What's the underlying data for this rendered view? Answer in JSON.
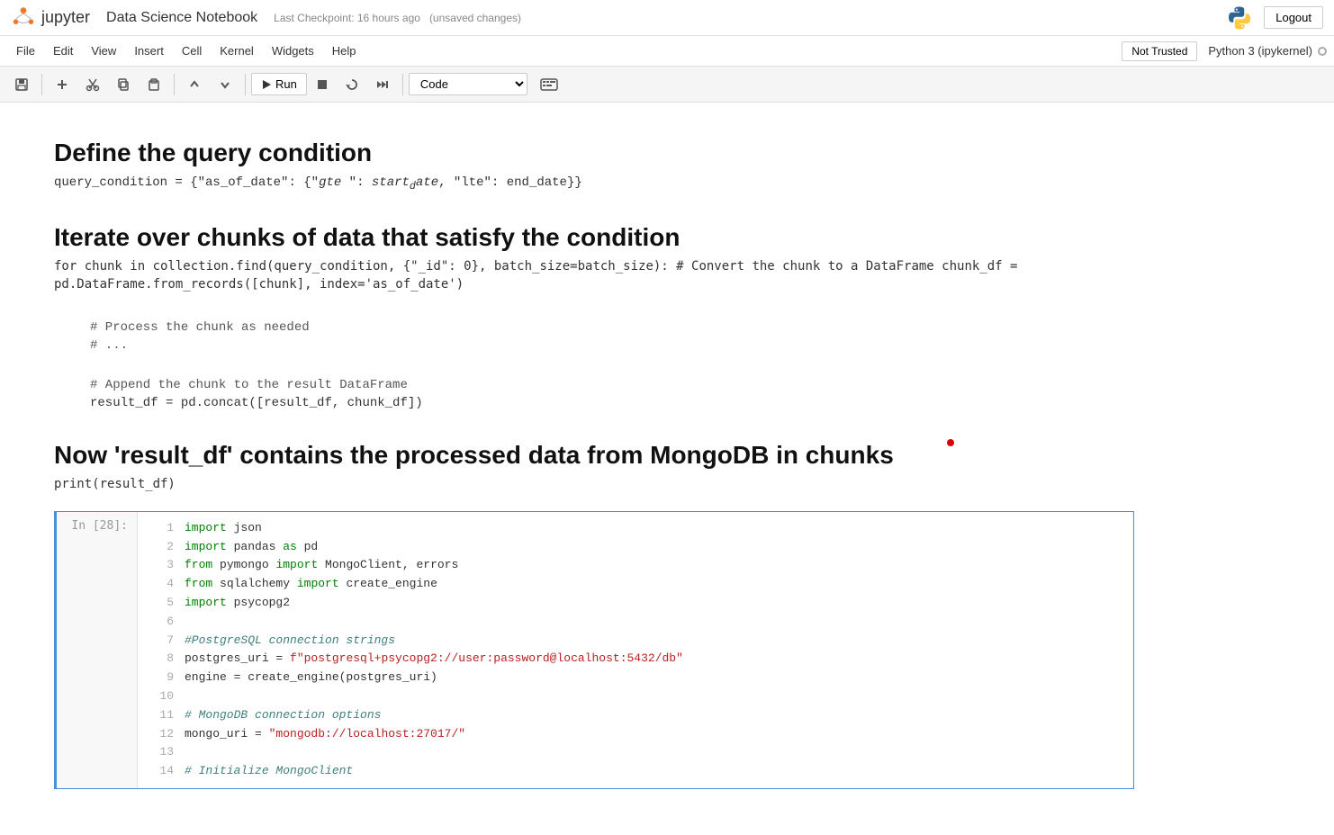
{
  "topbar": {
    "brand": "jupyter",
    "notebook_title": "Data Science Notebook",
    "checkpoint_text": "Last Checkpoint: 16 hours ago",
    "unsaved": "(unsaved changes)",
    "logout_label": "Logout"
  },
  "menubar": {
    "items": [
      "File",
      "Edit",
      "View",
      "Insert",
      "Cell",
      "Kernel",
      "Widgets",
      "Help"
    ],
    "not_trusted_label": "Not Trusted",
    "kernel_info": "Python 3 (ipykernel)"
  },
  "toolbar": {
    "cell_type": "Code",
    "run_label": "Run"
  },
  "notebook": {
    "section1": {
      "heading": "Define the query condition",
      "code_line": "query_condition = {\"as_of_date\": {\"gte \": start_date, \"lte\": end_date}}"
    },
    "section2": {
      "heading": "Iterate over chunks of data that satisfy the condition",
      "code_line1": "for chunk in collection.find(query_condition, {\"_id\": 0}, batch_size=batch_size): # Convert the chunk to a DataFrame chunk_df =",
      "code_line2": "pd.DataFrame.from_records([chunk], index='as_of_date')",
      "comment1": "# Process the chunk as needed",
      "comment2": "# ...",
      "comment3": "# Append the chunk to the result DataFrame",
      "code_concat": "result_df = pd.concat([result_df, chunk_df])"
    },
    "section3": {
      "heading": "Now 'result_df' contains the processed data from MongoDB in chunks",
      "print_line": "print(result_df)"
    },
    "code_cell": {
      "prompt": "In [28]:",
      "lines": [
        {
          "num": 1,
          "code": "import json",
          "parts": [
            {
              "text": "import ",
              "cls": "kw"
            },
            {
              "text": "json",
              "cls": "normal"
            }
          ]
        },
        {
          "num": 2,
          "code": "import pandas as pd",
          "parts": [
            {
              "text": "import ",
              "cls": "kw"
            },
            {
              "text": "pandas ",
              "cls": "normal"
            },
            {
              "text": "as",
              "cls": "kw2"
            },
            {
              "text": " pd",
              "cls": "normal"
            }
          ]
        },
        {
          "num": 3,
          "code": "from pymongo import MongoClient, errors",
          "parts": [
            {
              "text": "from ",
              "cls": "kw"
            },
            {
              "text": "pymongo ",
              "cls": "normal"
            },
            {
              "text": "import ",
              "cls": "kw"
            },
            {
              "text": "MongoClient, errors",
              "cls": "normal"
            }
          ]
        },
        {
          "num": 4,
          "code": "from sqlalchemy import create_engine",
          "parts": [
            {
              "text": "from ",
              "cls": "kw"
            },
            {
              "text": "sqlalchemy ",
              "cls": "normal"
            },
            {
              "text": "import ",
              "cls": "kw"
            },
            {
              "text": "create_engine",
              "cls": "normal"
            }
          ]
        },
        {
          "num": 5,
          "code": "import psycopg2",
          "parts": [
            {
              "text": "import ",
              "cls": "kw"
            },
            {
              "text": "psycopg2",
              "cls": "normal"
            }
          ]
        },
        {
          "num": 6,
          "code": "",
          "parts": []
        },
        {
          "num": 7,
          "code": "#PostgreSQL connection strings",
          "parts": [
            {
              "text": "#PostgreSQL connection strings",
              "cls": "cm"
            }
          ]
        },
        {
          "num": 8,
          "code": "postgres_uri = f\"postgresql+psycopg2://user:password@localhost:5432/db\"",
          "parts": [
            {
              "text": "postgres_uri ",
              "cls": "normal"
            },
            {
              "text": "= ",
              "cls": "normal"
            },
            {
              "text": "f\"postgresql+psycopg2://user:password@localhost:5432/db\"",
              "cls": "str"
            }
          ]
        },
        {
          "num": 9,
          "code": "engine = create_engine(postgres_uri)",
          "parts": [
            {
              "text": "engine ",
              "cls": "normal"
            },
            {
              "text": "= ",
              "cls": "normal"
            },
            {
              "text": "create_engine",
              "cls": "fn"
            },
            {
              "text": "(postgres_uri)",
              "cls": "normal"
            }
          ]
        },
        {
          "num": 10,
          "code": "",
          "parts": []
        },
        {
          "num": 11,
          "code": "# MongoDB connection options",
          "parts": [
            {
              "text": "# MongoDB connection options",
              "cls": "cm"
            }
          ]
        },
        {
          "num": 12,
          "code": "mongo_uri = \"mongodb://localhost:27017/\"",
          "parts": [
            {
              "text": "mongo_uri ",
              "cls": "normal"
            },
            {
              "text": "= ",
              "cls": "normal"
            },
            {
              "text": "\"mongodb://localhost:27017/\"",
              "cls": "str"
            }
          ]
        },
        {
          "num": 13,
          "code": "",
          "parts": []
        },
        {
          "num": 14,
          "code": "# Initialize MongoClient",
          "parts": [
            {
              "text": "# Initialize MongoClient",
              "cls": "cm"
            }
          ]
        }
      ]
    }
  }
}
